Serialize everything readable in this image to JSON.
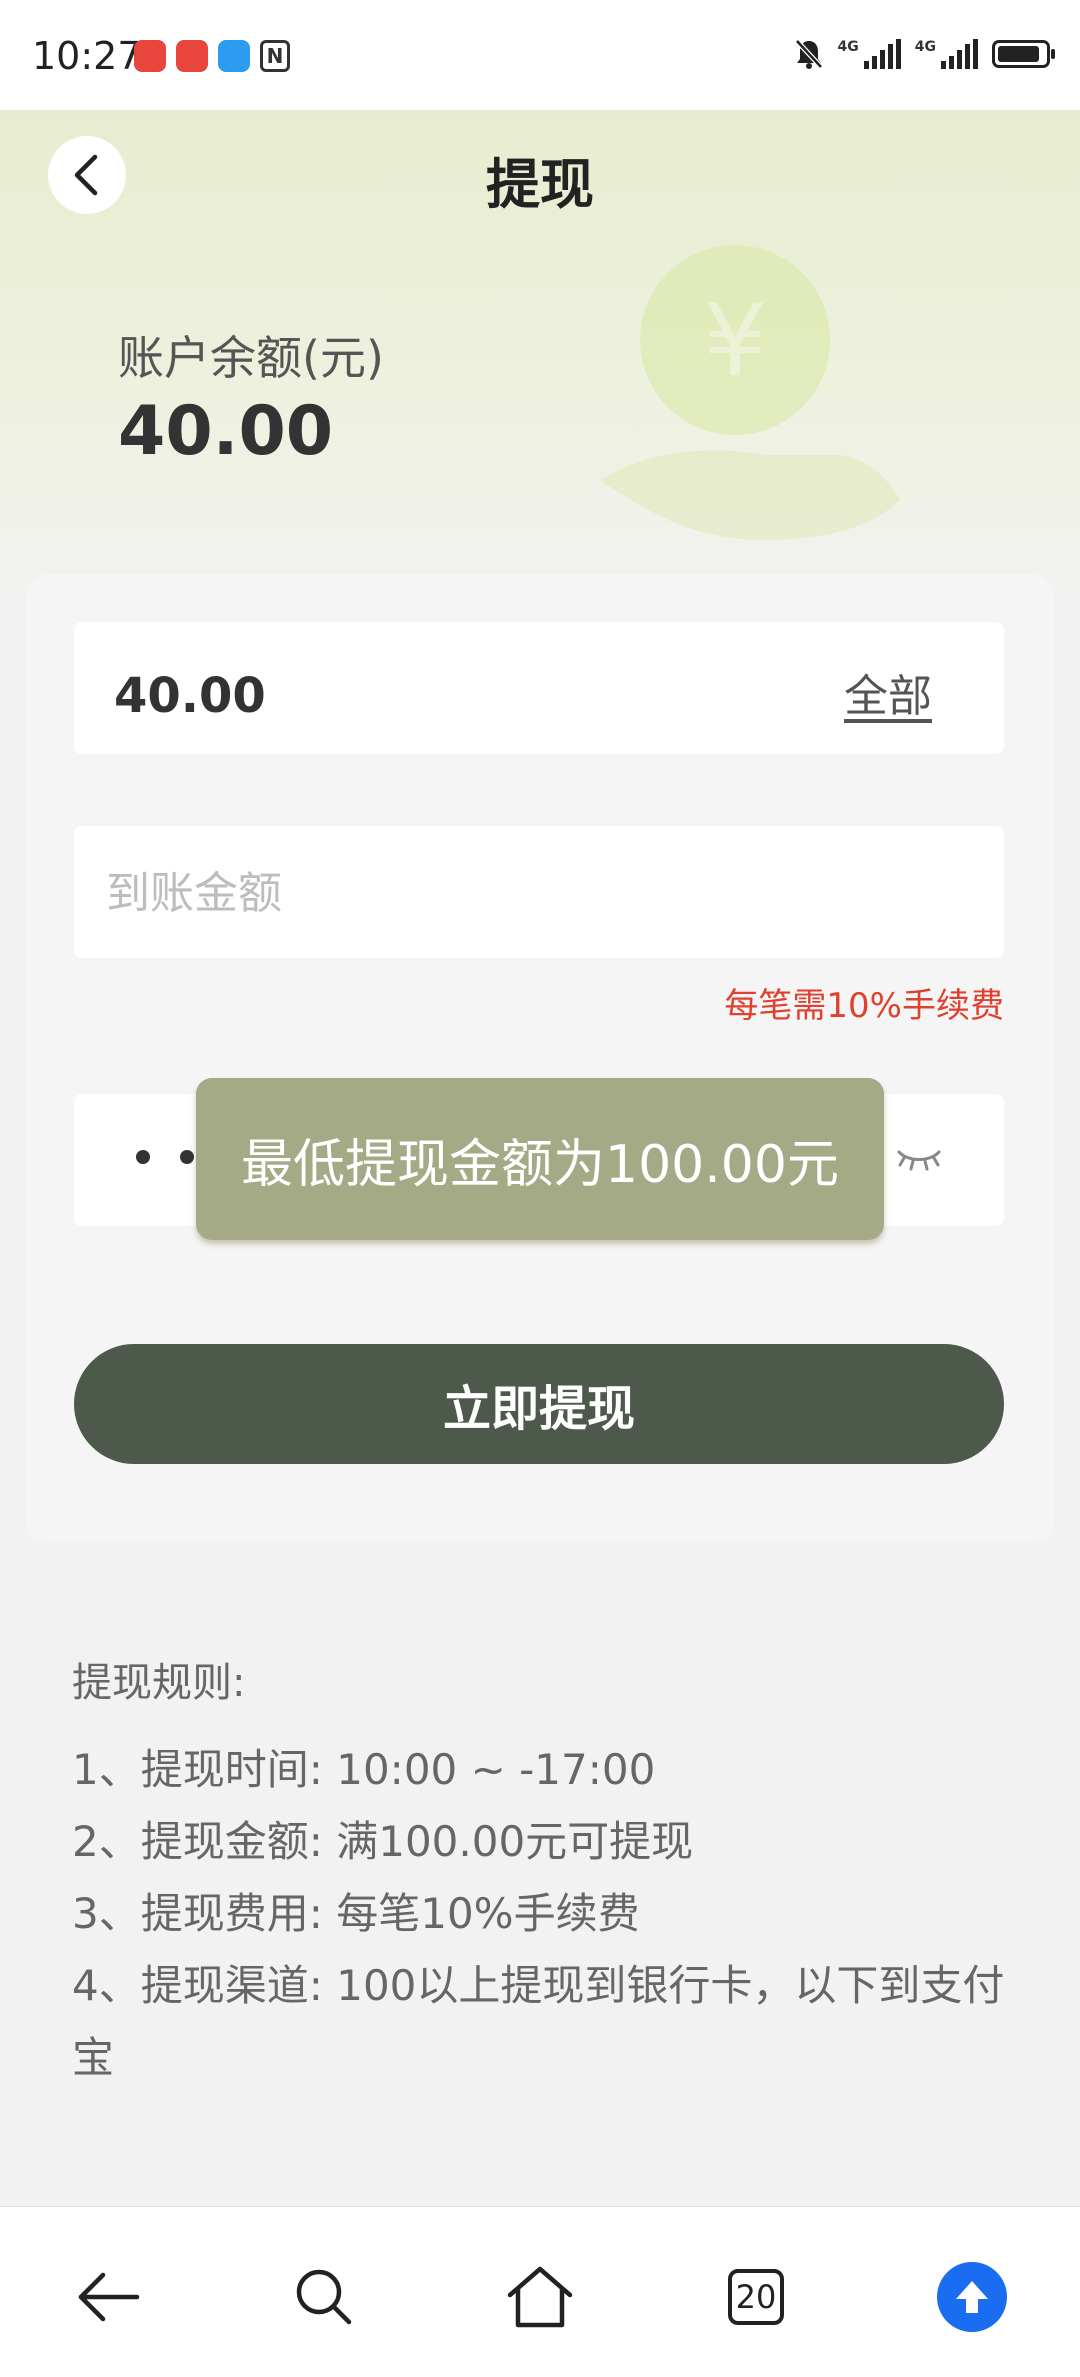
{
  "status_bar": {
    "time": "10:27",
    "network_1": "4G",
    "network_2": "4G",
    "battery_level": 0.9
  },
  "header": {
    "title": "提现"
  },
  "balance": {
    "label": "账户余额(元)",
    "value": "40.00"
  },
  "form": {
    "amount_value": "40.00",
    "all_label": "全部",
    "arrive_placeholder": "到账金额",
    "fee_note": "每笔需10%手续费",
    "submit_label": "立即提现"
  },
  "toast": {
    "message": "最低提现金额为100.00元"
  },
  "rules": {
    "title": "提现规则:",
    "items": [
      "1、提现时间:  10:00 ~ -17:00",
      "2、提现金额:  满100.00元可提现",
      "3、提现费用:  每笔10%手续费",
      "4、提现渠道:  100以上提现到银行卡，以下到支付宝"
    ]
  },
  "bottom_nav": {
    "tab_count": "20"
  },
  "colors": {
    "accent": "#4d5a4b",
    "toast": "#a5aa86",
    "fee_note": "#e0402e",
    "upload": "#1a6df0"
  }
}
